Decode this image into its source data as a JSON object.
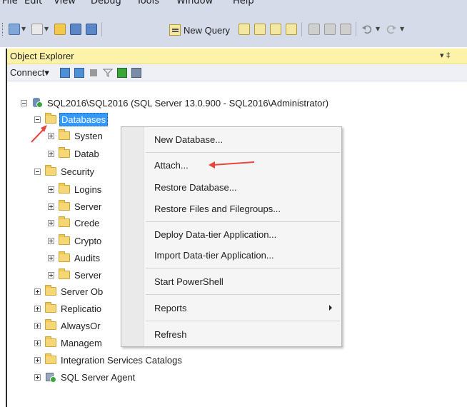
{
  "menubar": {
    "items": [
      "File",
      "Edit",
      "View",
      "Debug",
      "Tools",
      "Window",
      "Help"
    ]
  },
  "toolbar": {
    "new_query_label": "New Query"
  },
  "object_explorer": {
    "title": "Object Explorer",
    "pin_glyph": "▾ ‡",
    "connect_label": "Connect▾",
    "server_label": "SQL2016\\SQL2016 (SQL Server 13.0.900 - SQL2016\\Administrator)",
    "tree": [
      {
        "label": "Databases",
        "expander": "minus",
        "selected": true
      },
      {
        "label": "Systen",
        "expander": "plus"
      },
      {
        "label": "Datab",
        "expander": "plus"
      },
      {
        "label": "Security",
        "expander": "minus"
      },
      {
        "label": "Logins",
        "expander": "plus"
      },
      {
        "label": "Server",
        "expander": "plus"
      },
      {
        "label": "Crede",
        "expander": "plus"
      },
      {
        "label": "Crypto",
        "expander": "plus"
      },
      {
        "label": "Audits",
        "expander": "plus"
      },
      {
        "label": "Server",
        "expander": "plus"
      },
      {
        "label": "Server Ob",
        "expander": "plus"
      },
      {
        "label": "Replicatio",
        "expander": "plus"
      },
      {
        "label": "AlwaysOr",
        "expander": "plus"
      },
      {
        "label": "Managem",
        "expander": "plus"
      },
      {
        "label": "Integration Services Catalogs",
        "expander": "plus"
      },
      {
        "label": "SQL Server Agent",
        "expander": "plus"
      }
    ]
  },
  "context_menu": {
    "items": [
      {
        "label": "New Database..."
      },
      {
        "label": "Attach..."
      },
      {
        "label": "Restore Database..."
      },
      {
        "label": "Restore Files and Filegroups..."
      },
      {
        "label": "Deploy Data-tier Application..."
      },
      {
        "label": "Import Data-tier Application..."
      },
      {
        "label": "Start PowerShell"
      },
      {
        "label": "Reports"
      },
      {
        "label": "Refresh"
      }
    ]
  },
  "colors": {
    "selection": "#3399ff",
    "annotation_arrow": "#e8453c",
    "panel_title": "#fdf3a8"
  }
}
